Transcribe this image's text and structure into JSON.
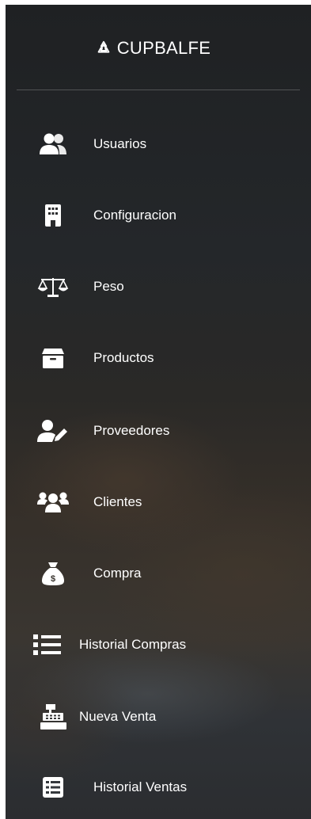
{
  "brand": {
    "icon": "recycle-icon",
    "title": "CUPBALFE"
  },
  "menu": [
    {
      "label": "Usuarios",
      "icon": "users-icon"
    },
    {
      "label": "Configuracion",
      "icon": "building-icon"
    },
    {
      "label": "Peso",
      "icon": "balance-scale-icon"
    },
    {
      "label": "Productos",
      "icon": "box-icon"
    },
    {
      "label": "Proveedores",
      "icon": "user-edit-icon"
    },
    {
      "label": "Clientes",
      "icon": "user-group-icon"
    },
    {
      "label": "Compra",
      "icon": "money-bag-icon"
    },
    {
      "label": "Historial Compras",
      "icon": "list-icon"
    },
    {
      "label": "Nueva Venta",
      "icon": "cash-register-icon"
    },
    {
      "label": "Historial Ventas",
      "icon": "list-alt-icon"
    }
  ]
}
